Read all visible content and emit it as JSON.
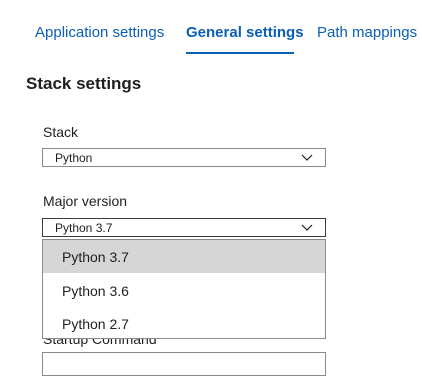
{
  "tabs": [
    {
      "label": "Application settings"
    },
    {
      "label": "General settings",
      "selected": true
    },
    {
      "label": "Path mappings"
    }
  ],
  "section_title": "Stack settings",
  "stack": {
    "label": "Stack",
    "value": "Python"
  },
  "major_version": {
    "label": "Major version",
    "value": "Python 3.7",
    "options": [
      "Python 3.7",
      "Python 3.6",
      "Python 2.7"
    ],
    "highlighted_option": "Python 3.7"
  },
  "startup_command": {
    "label": "Startup Command",
    "value": ""
  },
  "colors": {
    "accent": "#0a5fb5",
    "highlight": "#d6d6d6",
    "border": "#8a8a8a"
  },
  "icons": {
    "dropdown": "chevron-down-icon"
  }
}
